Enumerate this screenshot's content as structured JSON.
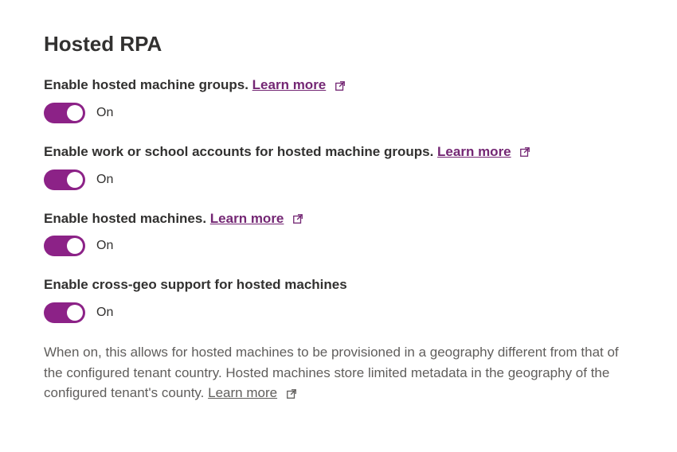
{
  "section": {
    "title": "Hosted RPA"
  },
  "settings": {
    "hostedMachineGroups": {
      "label": "Enable hosted machine groups.",
      "learnMore": "Learn more",
      "toggleState": "On"
    },
    "workSchoolAccounts": {
      "label": "Enable work or school accounts for hosted machine groups.",
      "learnMore": "Learn more",
      "toggleState": "On"
    },
    "hostedMachines": {
      "label": "Enable hosted machines.",
      "learnMore": "Learn more",
      "toggleState": "On"
    },
    "crossGeo": {
      "label": "Enable cross-geo support for hosted machines",
      "toggleState": "On",
      "description": "When on, this allows for hosted machines to be provisioned in a geography different from that of the configured tenant country. Hosted machines store limited metadata in the geography of the configured tenant's county.",
      "learnMore": "Learn more"
    }
  }
}
